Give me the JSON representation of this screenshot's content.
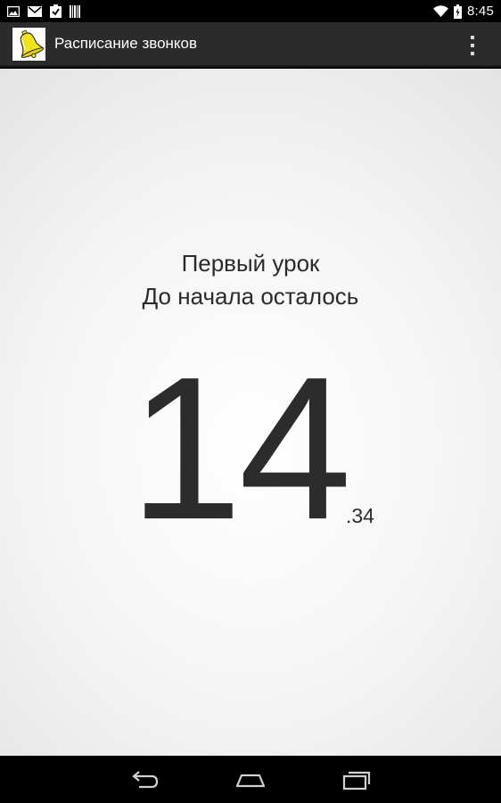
{
  "status_bar": {
    "time": "8:45",
    "left_icons": [
      "image-icon",
      "gmail-icon",
      "clipboard-check-icon",
      "barcode-icon"
    ],
    "right_icons": [
      "wifi-icon",
      "battery-icon"
    ]
  },
  "action_bar": {
    "title": "Расписание звонков",
    "icon": "bell-icon",
    "overflow_icon": "overflow-menu-icon"
  },
  "main": {
    "lesson_name": "Первый урок",
    "status_text": "До начала осталось",
    "minutes": "14",
    "seconds": ".34"
  },
  "nav_bar": {
    "buttons": [
      "back-icon",
      "home-icon",
      "recent-apps-icon"
    ]
  },
  "colors": {
    "status_bar": "#000000",
    "action_bar": "#2b2b2b",
    "bell_yellow": "#f2e41c",
    "text_dark": "#2c2c2c"
  }
}
